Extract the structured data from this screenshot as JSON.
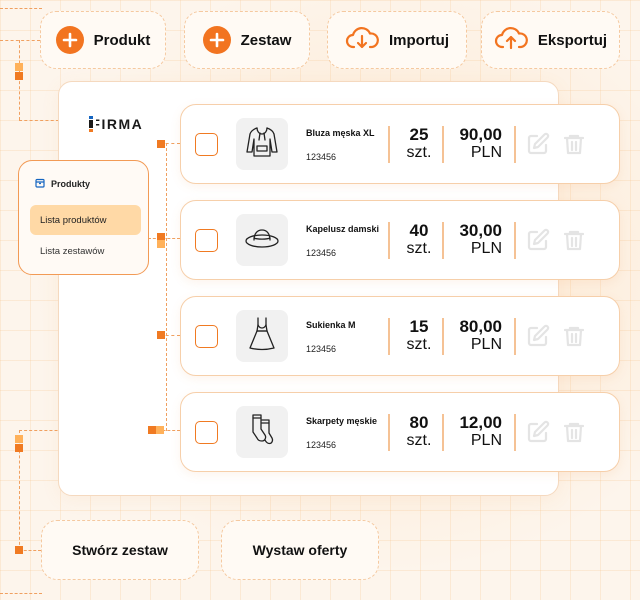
{
  "toolbar": {
    "add_product": "Produkt",
    "add_set": "Zestaw",
    "import": "Importuj",
    "export": "Eksportuj"
  },
  "logo": {
    "text": "IFIRMA",
    "brand_colors": [
      "#1565c0",
      "#f07a22"
    ]
  },
  "sidebar": {
    "heading": "Produkty",
    "items": [
      {
        "label": "Lista produktów",
        "active": true
      },
      {
        "label": "Lista zestawów",
        "active": false
      }
    ]
  },
  "products": [
    {
      "name": "Bluza męska XL",
      "code": "123456",
      "qty": "25",
      "unit": "szt.",
      "price": "90,00",
      "currency": "PLN",
      "icon": "hoodie-icon"
    },
    {
      "name": "Kapelusz damski",
      "code": "123456",
      "qty": "40",
      "unit": "szt.",
      "price": "30,00",
      "currency": "PLN",
      "icon": "hat-icon"
    },
    {
      "name": "Sukienka M",
      "code": "123456",
      "qty": "15",
      "unit": "szt.",
      "price": "80,00",
      "currency": "PLN",
      "icon": "dress-icon"
    },
    {
      "name": "Skarpety męskie",
      "code": "123456",
      "qty": "80",
      "unit": "szt.",
      "price": "12,00",
      "currency": "PLN",
      "icon": "socks-icon"
    }
  ],
  "actions": {
    "create_set": "Stwórz zestaw",
    "publish_offers": "Wystaw oferty"
  },
  "colors": {
    "accent": "#f27420",
    "accent_light": "#ffd9a6",
    "background": "#fdf5ec",
    "icon_muted": "#e6e6e6"
  }
}
